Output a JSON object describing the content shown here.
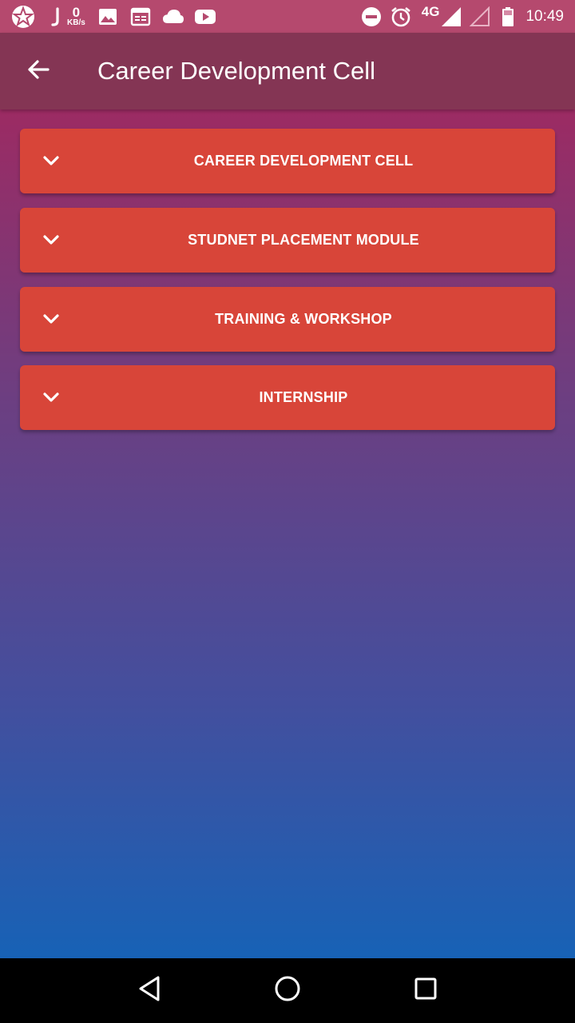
{
  "status_bar": {
    "net_speed_value": "0",
    "net_speed_unit": "KB/s",
    "network_type": "4G",
    "time": "10:49",
    "icons": [
      "notification-star-icon",
      "j-app-icon",
      "image-icon",
      "calendar-icon",
      "cloud-icon",
      "youtube-icon",
      "dnd-icon",
      "alarm-icon",
      "signal-full-icon",
      "signal-empty-icon",
      "battery-icon"
    ]
  },
  "app_bar": {
    "title": "Career Development Cell",
    "back_icon": "arrow-back-icon"
  },
  "panels": [
    {
      "label": "CAREER DEVELOPMENT CELL",
      "icon": "chevron-down-icon"
    },
    {
      "label": "STUDNET PLACEMENT MODULE",
      "icon": "chevron-down-icon"
    },
    {
      "label": "TRAINING & WORKSHOP",
      "icon": "chevron-down-icon"
    },
    {
      "label": "INTERNSHIP",
      "icon": "chevron-down-icon"
    }
  ],
  "nav_bar": {
    "icons": [
      "nav-back-icon",
      "nav-home-icon",
      "nav-recents-icon"
    ]
  },
  "colors": {
    "status_bar": "#b5496e",
    "app_bar": "#843554",
    "panel": "#d84539",
    "gradient_top": "#9c2b63",
    "gradient_bottom": "#1762b6"
  }
}
